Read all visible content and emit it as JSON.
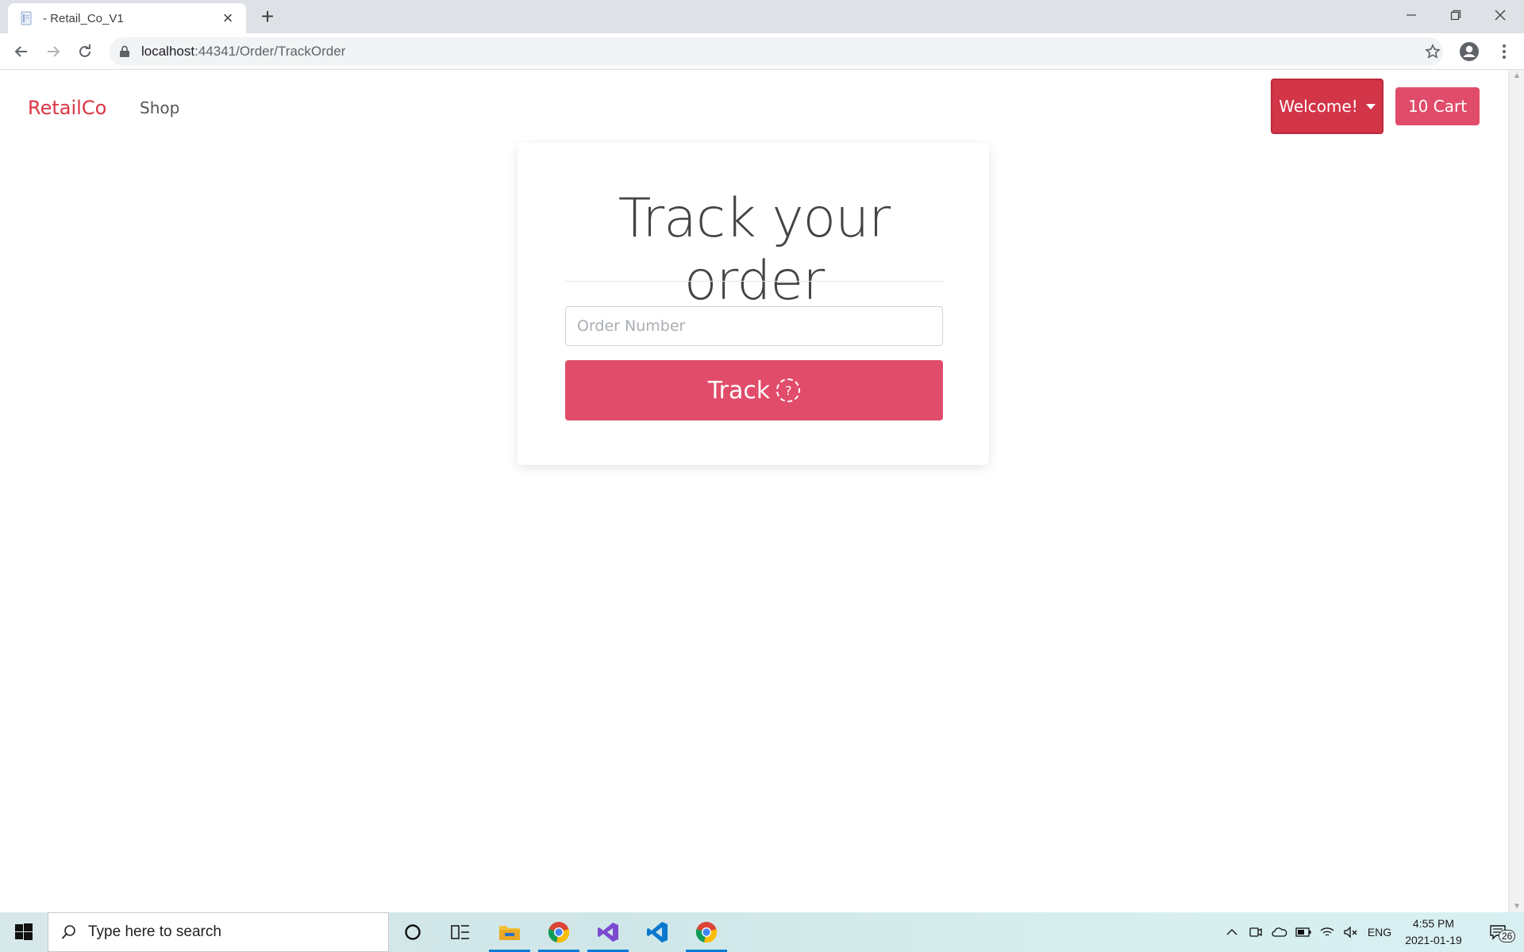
{
  "browser": {
    "tab_title": "- Retail_Co_V1",
    "url_host": "localhost",
    "url_rest": ":44341/Order/TrackOrder"
  },
  "nav": {
    "brand": "RetailCo",
    "shop": "Shop",
    "welcome": "Welcome!",
    "cart": "10 Cart"
  },
  "card": {
    "title": "Track your order",
    "input_placeholder": "Order Number",
    "track_label": "Track",
    "spinner_glyph": "?"
  },
  "colors": {
    "brand": "#dc3545",
    "primary_button": "#e14c6a",
    "welcome_button": "#d33548"
  },
  "taskbar": {
    "search_placeholder": "Type here to search",
    "language": "ENG",
    "time": "4:55 PM",
    "date": "2021-01-19",
    "notification_count": "26"
  }
}
